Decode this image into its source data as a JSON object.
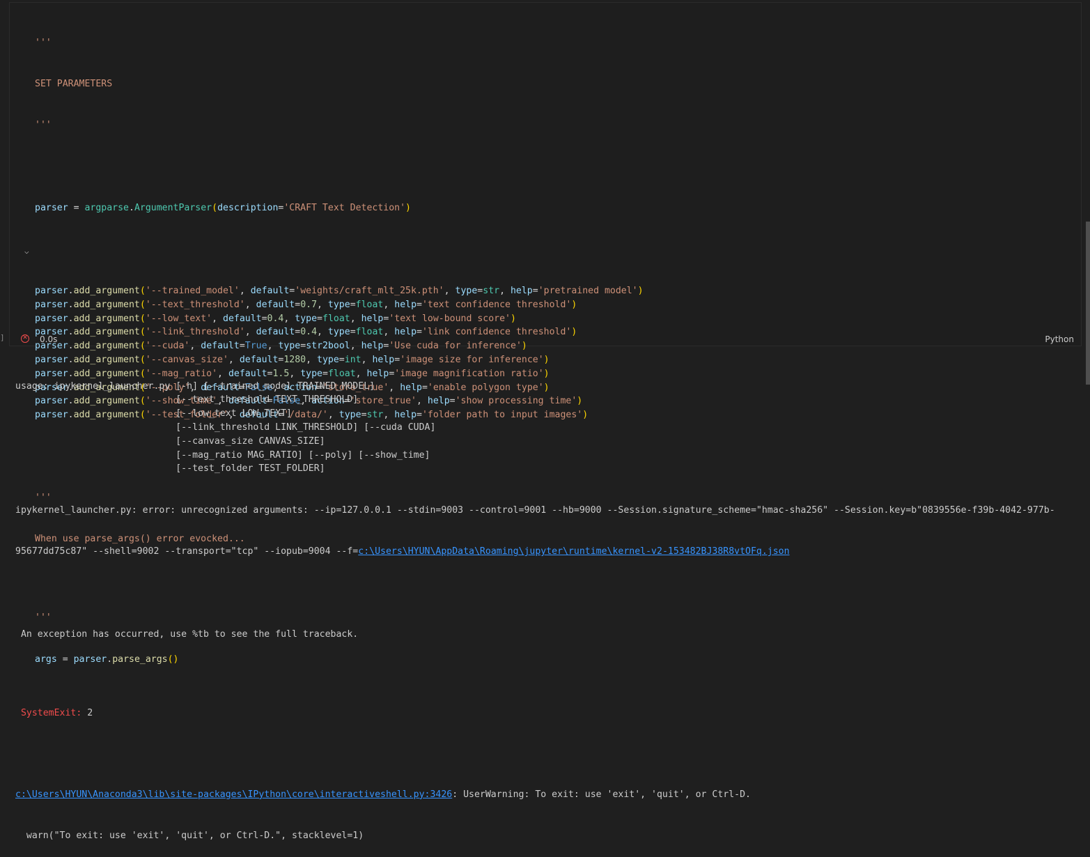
{
  "cell": {
    "docstring_open": "'''",
    "docstring_text": "SET PARAMETERS",
    "docstring_close": "'''",
    "parser_line": {
      "var": "parser",
      "eq": " = ",
      "module": "argparse",
      "dot": ".",
      "cls": "ArgumentParser",
      "open": "(",
      "arg": "description",
      "eq2": "=",
      "str": "'CRAFT Text Detection'",
      "close": ")"
    },
    "add_argument_lines": [
      "parser.add_argument('--trained_model', default='weights/craft_mlt_25k.pth', type=str, help='pretrained model')",
      "parser.add_argument('--text_threshold', default=0.7, type=float, help='text confidence threshold')",
      "parser.add_argument('--low_text', default=0.4, type=float, help='text low-bound score')",
      "parser.add_argument('--link_threshold', default=0.4, type=float, help='link confidence threshold')",
      "parser.add_argument('--cuda', default=True, type=str2bool, help='Use cuda for inference')",
      "parser.add_argument('--canvas_size', default=1280, type=int, help='image size for inference')",
      "parser.add_argument('--mag_ratio', default=1.5, type=float, help='image magnification ratio')",
      "parser.add_argument('--poly', default=False, action='store_true', help='enable polygon type')",
      "parser.add_argument('--show_time', default=False, action='store_true', help='show processing time')",
      "parser.add_argument('--test_folder', default='/data/', type=str, help='folder path to input images')"
    ],
    "docstring2_open": "'''",
    "docstring2_text": "When use parse_args() error evocked...",
    "docstring2_close": "'''",
    "args_line": "args = parser.parse_args()",
    "exec_time": "0.0s",
    "language": "Python",
    "fold_icon": "chevron-down-icon",
    "status_icon": "error-circle-icon"
  },
  "output": {
    "usage_lines": [
      "usage: ipykernel_launcher.py [-h] [--trained_model TRAINED_MODEL]",
      "                             [--text_threshold TEXT_THRESHOLD]",
      "                             [--low_text LOW_TEXT]",
      "                             [--link_threshold LINK_THRESHOLD] [--cuda CUDA]",
      "                             [--canvas_size CANVAS_SIZE]",
      "                             [--mag_ratio MAG_RATIO] [--poly] [--show_time]",
      "                             [--test_folder TEST_FOLDER]"
    ],
    "error_line1": "ipykernel_launcher.py: error: unrecognized arguments: --ip=127.0.0.1 --stdin=9003 --control=9001 --hb=9000 --Session.signature_scheme=\"hmac-sha256\" --Session.key=b\"0839556e-f39b-4042-977b-",
    "error_line2_prefix": "95677dd75c87\" --shell=9002 --transport=\"tcp\" --iopub=9004 --f=",
    "error_line2_link": "c:\\Users\\HYUN\\AppData\\Roaming\\jupyter\\runtime\\kernel-v2-153482BJ38R8vtOFq.json",
    "exception_msg": " An exception has occurred, use %tb to see the full traceback.",
    "sysexit_label": " SystemExit:",
    "sysexit_code": " 2",
    "warning_link": "c:\\Users\\HYUN\\Anaconda3\\lib\\site-packages\\IPython\\core\\interactiveshell.py:3426",
    "warning_text": ": UserWarning: To exit: use 'exit', 'quit', or Ctrl-D.",
    "warn_call": "  warn(\"To exit: use 'exit', 'quit', or Ctrl-D.\", stacklevel=1)"
  },
  "colors": {
    "string": "#ce9178",
    "keyword_arg": "#9cdcfe",
    "class": "#4ec9b0",
    "function": "#dcdcaa",
    "error": "#f14c4c",
    "link": "#3794ff"
  }
}
